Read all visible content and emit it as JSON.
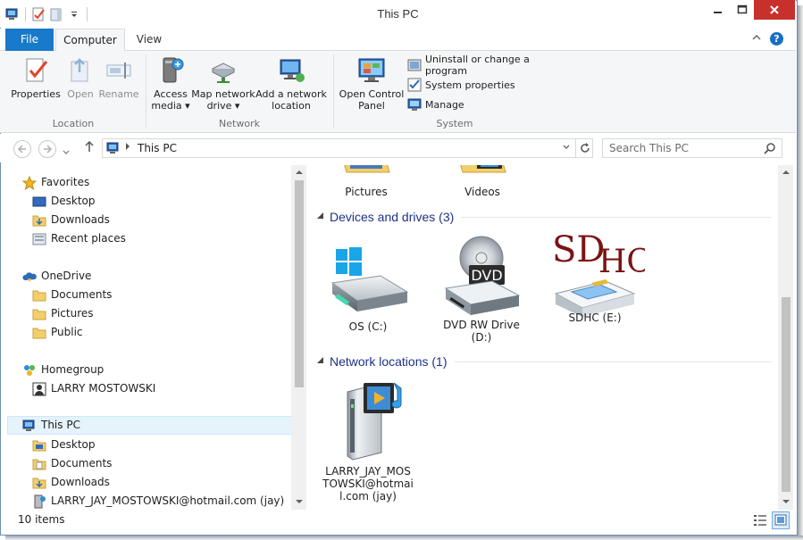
{
  "window": {
    "title": "This PC"
  },
  "ribbon_tabs": [
    {
      "label": "File"
    },
    {
      "label": "Computer"
    },
    {
      "label": "View"
    }
  ],
  "ribbon": {
    "location": {
      "label": "Location",
      "properties": "Properties",
      "open": "Open",
      "rename": "Rename"
    },
    "network": {
      "label": "Network",
      "access_media_l1": "Access",
      "access_media_l2": "media ▾",
      "map_drive_l1": "Map network",
      "map_drive_l2": "drive ▾",
      "add_location_l1": "Add a network",
      "add_location_l2": "location"
    },
    "system": {
      "label": "System",
      "control_panel_l1": "Open Control",
      "control_panel_l2": "Panel",
      "uninstall": "Uninstall or change a program",
      "system_properties": "System properties",
      "manage": "Manage"
    }
  },
  "address": {
    "crumb": "This PC",
    "search_placeholder": "Search This PC"
  },
  "nav_pane": {
    "favorites": "Favorites",
    "desktop": "Desktop",
    "downloads": "Downloads",
    "recent": "Recent places",
    "onedrive": "OneDrive",
    "od_documents": "Documents",
    "od_pictures": "Pictures",
    "od_public": "Public",
    "homegroup": "Homegroup",
    "hg_user": "LARRY MOSTOWSKI",
    "this_pc": "This PC",
    "pc_desktop": "Desktop",
    "pc_documents": "Documents",
    "pc_downloads": "Downloads",
    "pc_account": "LARRY_JAY_MOSTOWSKI@hotmail.com (jay)"
  },
  "content": {
    "folders": {
      "pictures": "Pictures",
      "videos": "Videos"
    },
    "devices_header": "Devices and drives (3)",
    "drive_c": "OS (C:)",
    "drive_d_l1": "DVD RW Drive",
    "drive_d_l2": "(D:)",
    "drive_e": "SDHC (E:)",
    "drive_e_badge_sd": "SD",
    "drive_e_badge_hc": "HC",
    "dvd_label": "DVD",
    "network_header": "Network locations (1)",
    "net_l1": "LARRY_JAY_MOS",
    "net_l2": "TOWSKI@hotmai",
    "net_l3": "l.com (jay)"
  },
  "status": {
    "items": "10 items"
  }
}
